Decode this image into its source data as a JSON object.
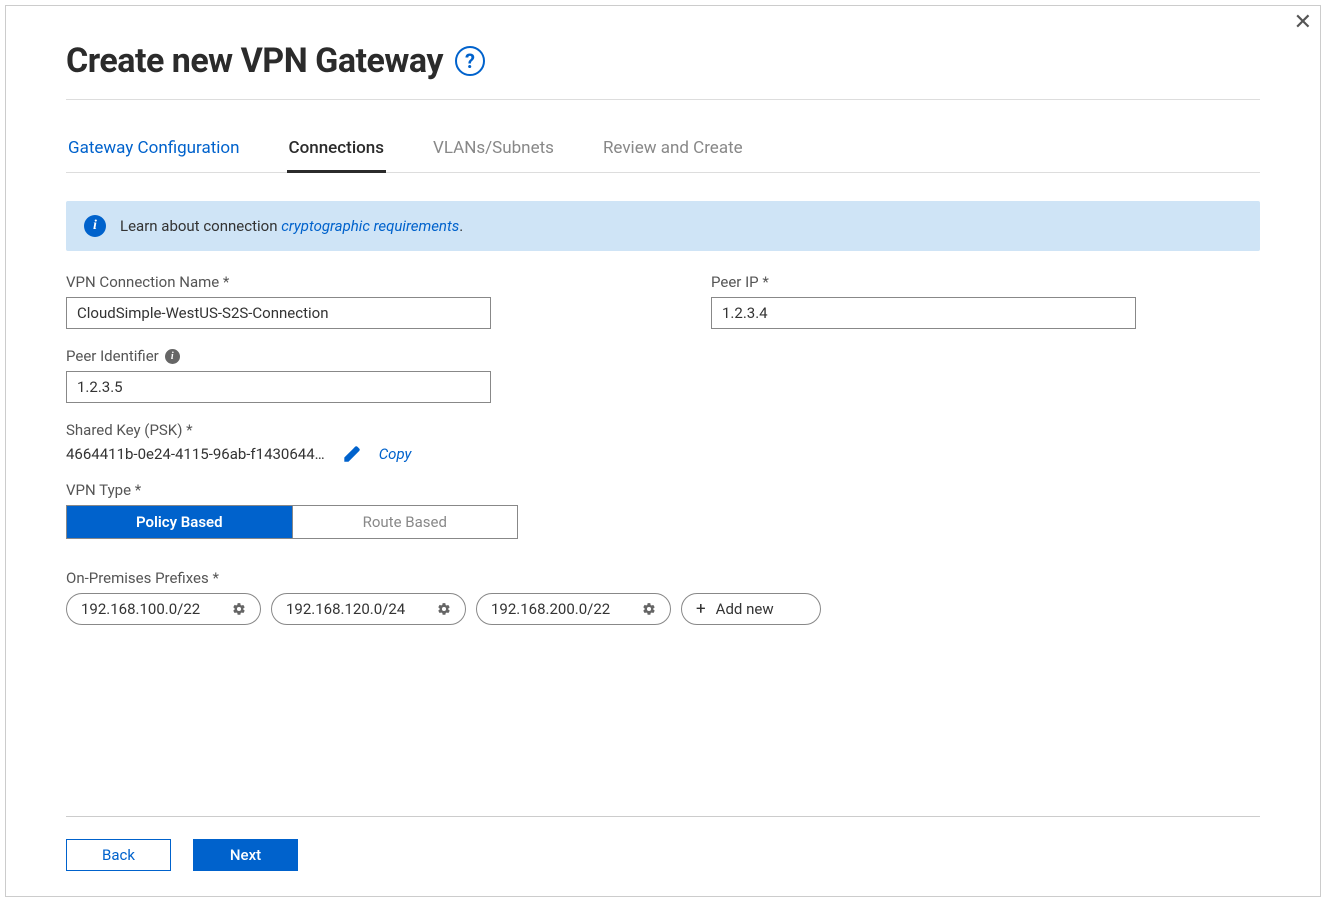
{
  "header": {
    "title": "Create new VPN Gateway"
  },
  "tabs": {
    "t0": "Gateway Configuration",
    "t1": "Connections",
    "t2": "VLANs/Subnets",
    "t3": "Review and Create"
  },
  "banner": {
    "prefix": "Learn about connection ",
    "link": "cryptographic requirements",
    "suffix": "."
  },
  "fields": {
    "vpn_name_label": "VPN Connection Name  *",
    "vpn_name_value": "CloudSimple-WestUS-S2S-Connection",
    "peer_ip_label": "Peer IP  *",
    "peer_ip_value": "1.2.3.4",
    "peer_id_label": "Peer Identifier",
    "peer_id_value": "1.2.3.5",
    "psk_label": "Shared Key  (PSK) *",
    "psk_value": "4664411b-0e24-4115-96ab-f1430644…",
    "copy_label": "Copy",
    "vpn_type_label": "VPN Type *",
    "vpn_type_policy": "Policy Based",
    "vpn_type_route": "Route Based",
    "prefixes_label": "On-Premises Prefixes  *",
    "prefixes": {
      "p0": "192.168.100.0/22",
      "p1": "192.168.120.0/24",
      "p2": "192.168.200.0/22"
    },
    "add_new": "Add new"
  },
  "footer": {
    "back": "Back",
    "next": "Next"
  }
}
